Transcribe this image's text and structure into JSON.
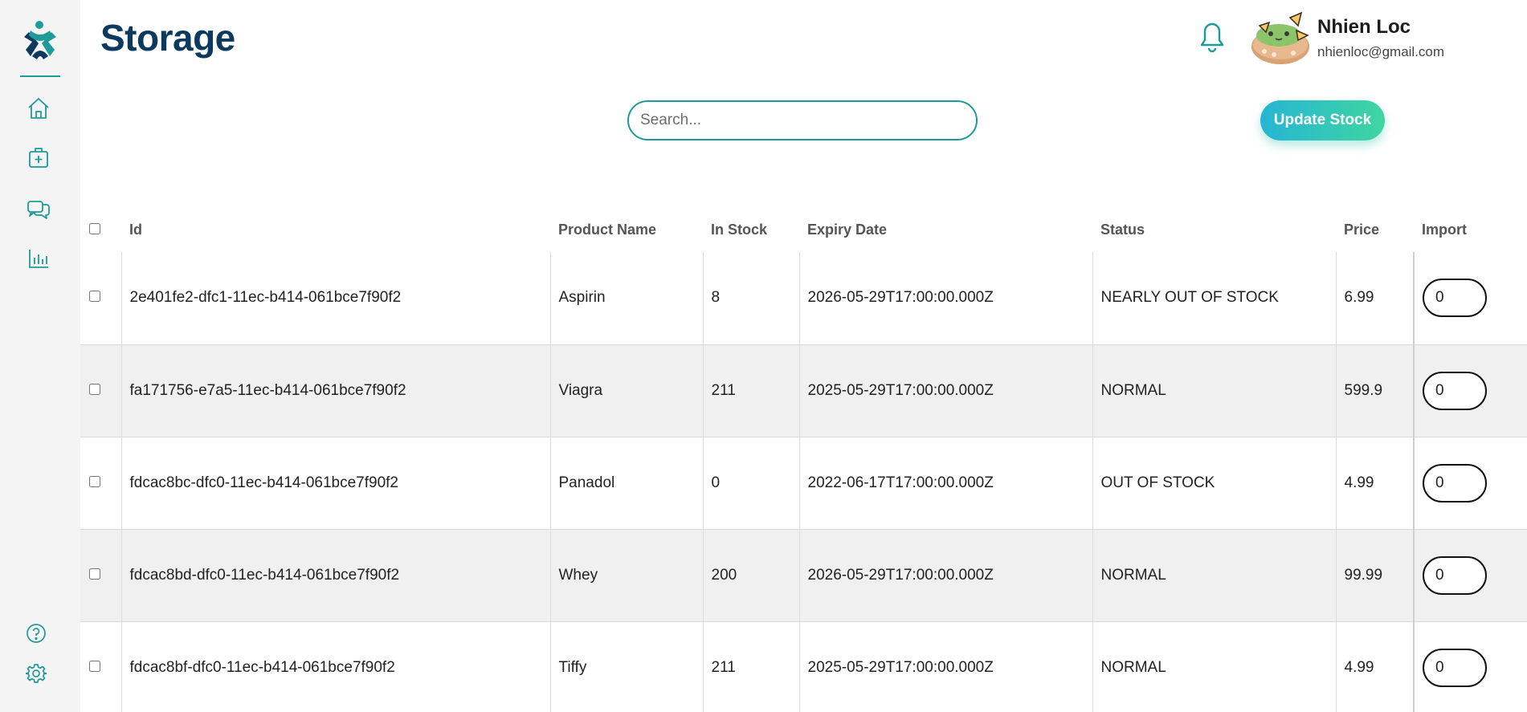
{
  "header": {
    "title": "Storage",
    "user_name": "Nhien Loc",
    "user_email": "nhienloc@gmail.com"
  },
  "search": {
    "placeholder": "Search...",
    "value": ""
  },
  "actions": {
    "update_label": "Update Stock"
  },
  "sidebar": {
    "items": [
      {
        "name": "home",
        "icon": "home-icon"
      },
      {
        "name": "medicine",
        "icon": "medical-bag-icon"
      },
      {
        "name": "messages",
        "icon": "chat-icon"
      },
      {
        "name": "reports",
        "icon": "bar-chart-icon"
      },
      {
        "name": "help",
        "icon": "help-icon"
      },
      {
        "name": "settings",
        "icon": "gear-icon"
      }
    ]
  },
  "colors": {
    "accent": "#1e9a98",
    "title": "#0c3a5e",
    "gradient_start": "#26b5d4",
    "gradient_end": "#3fd6a0"
  },
  "table": {
    "columns": [
      "Id",
      "Product Name",
      "In Stock",
      "Expiry Date",
      "Status",
      "Price",
      "Import"
    ],
    "rows": [
      {
        "id": "2e401fe2-dfc1-11ec-b414-061bce7f90f2",
        "name": "Aspirin",
        "stock": "8",
        "expiry": "2026-05-29T17:00:00.000Z",
        "status": "NEARLY OUT OF STOCK",
        "price": "6.99",
        "import": "0"
      },
      {
        "id": "fa171756-e7a5-11ec-b414-061bce7f90f2",
        "name": "Viagra",
        "stock": "211",
        "expiry": "2025-05-29T17:00:00.000Z",
        "status": "NORMAL",
        "price": "599.9",
        "import": "0"
      },
      {
        "id": "fdcac8bc-dfc0-11ec-b414-061bce7f90f2",
        "name": "Panadol",
        "stock": "0",
        "expiry": "2022-06-17T17:00:00.000Z",
        "status": "OUT OF STOCK",
        "price": "4.99",
        "import": "0"
      },
      {
        "id": "fdcac8bd-dfc0-11ec-b414-061bce7f90f2",
        "name": "Whey",
        "stock": "200",
        "expiry": "2026-05-29T17:00:00.000Z",
        "status": "NORMAL",
        "price": "99.99",
        "import": "0"
      },
      {
        "id": "fdcac8bf-dfc0-11ec-b414-061bce7f90f2",
        "name": "Tiffy",
        "stock": "211",
        "expiry": "2025-05-29T17:00:00.000Z",
        "status": "NORMAL",
        "price": "4.99",
        "import": "0"
      }
    ]
  }
}
